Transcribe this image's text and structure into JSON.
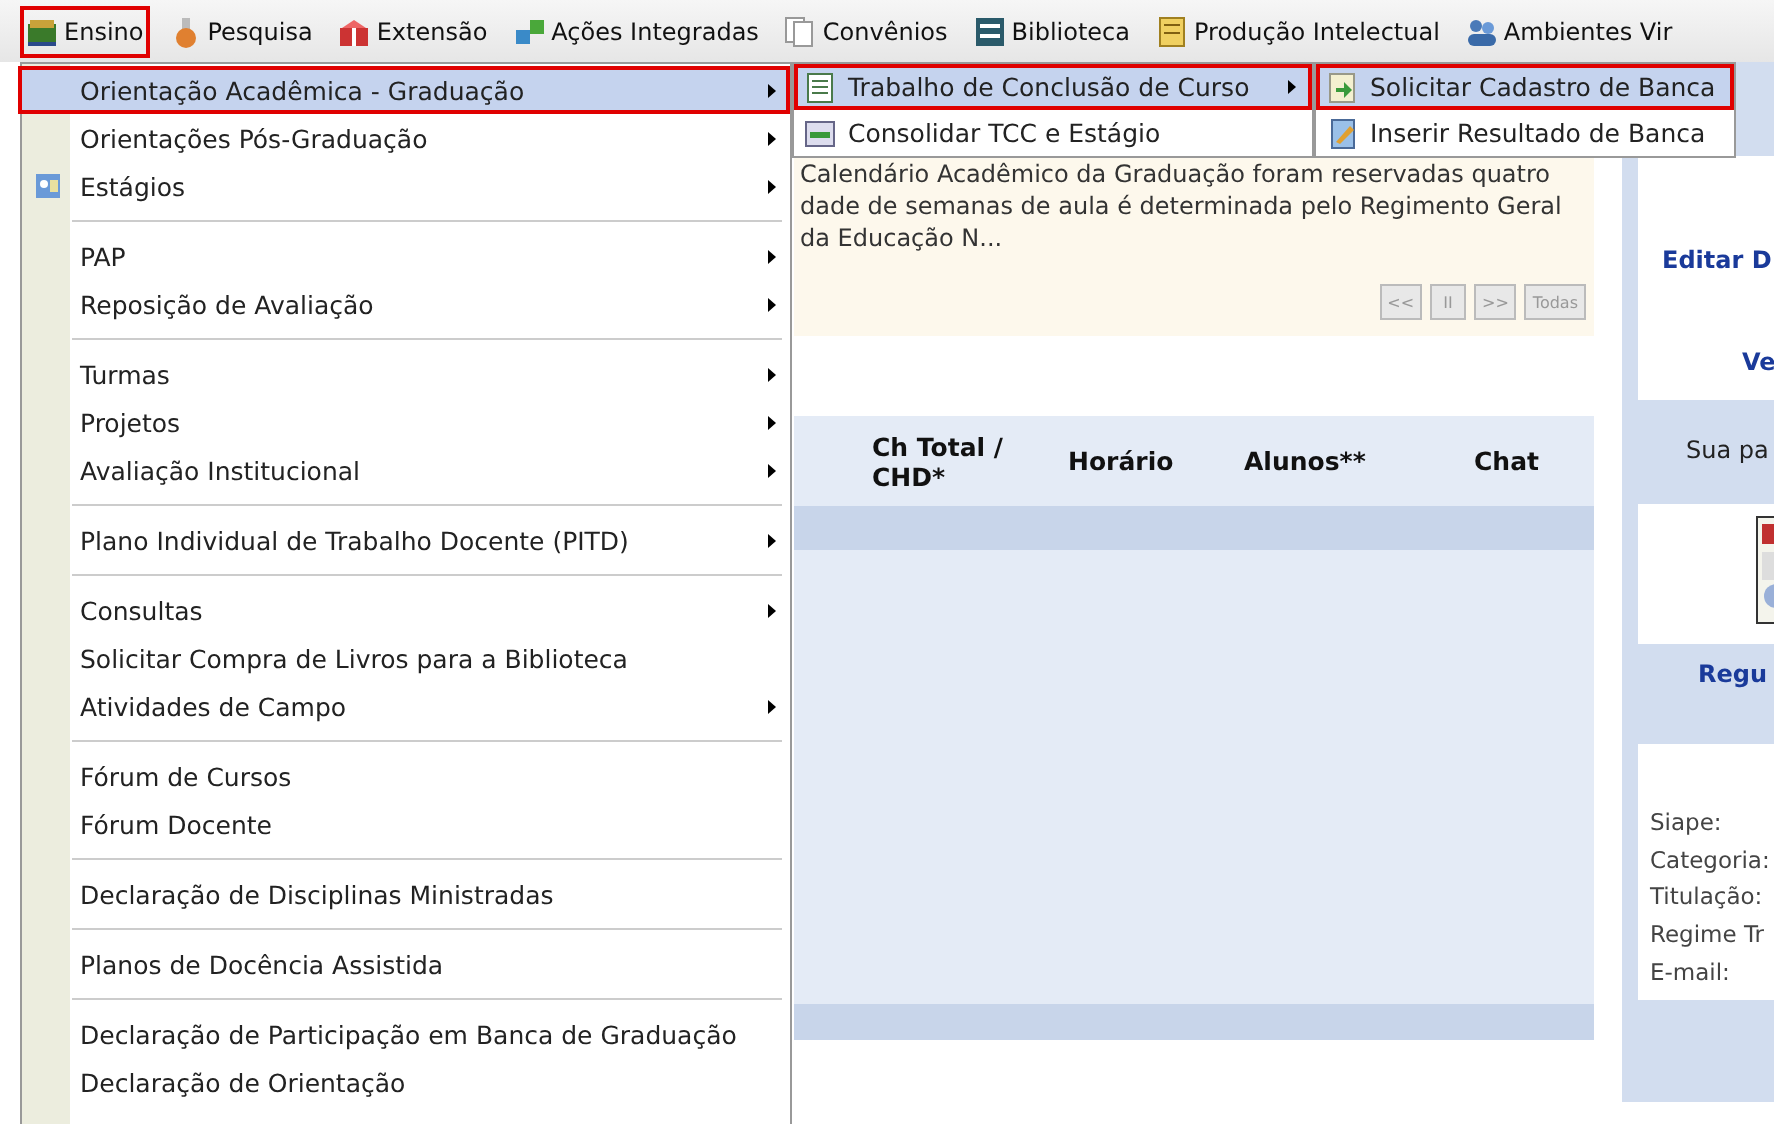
{
  "menubar": [
    {
      "label": "Ensino",
      "selected": true
    },
    {
      "label": "Pesquisa",
      "selected": false
    },
    {
      "label": "Extensão",
      "selected": false
    },
    {
      "label": "Ações Integradas",
      "selected": false
    },
    {
      "label": "Convênios",
      "selected": false
    },
    {
      "label": "Biblioteca",
      "selected": false
    },
    {
      "label": "Produção Intelectual",
      "selected": false
    },
    {
      "label": "Ambientes Vir",
      "selected": false
    }
  ],
  "menu": {
    "sections": [
      [
        {
          "label": "Orientação Acadêmica - Graduação",
          "has_submenu": true,
          "has_icon": false,
          "selected": true
        },
        {
          "label": "Orientações Pós-Graduação",
          "has_submenu": true,
          "has_icon": false,
          "selected": false
        },
        {
          "label": "Estágios",
          "has_submenu": true,
          "has_icon": true,
          "selected": false
        }
      ],
      [
        {
          "label": "PAP",
          "has_submenu": true,
          "has_icon": false,
          "selected": false
        },
        {
          "label": "Reposição de Avaliação",
          "has_submenu": true,
          "has_icon": false,
          "selected": false
        }
      ],
      [
        {
          "label": "Turmas",
          "has_submenu": true,
          "has_icon": false,
          "selected": false
        },
        {
          "label": "Projetos",
          "has_submenu": true,
          "has_icon": false,
          "selected": false
        },
        {
          "label": "Avaliação Institucional",
          "has_submenu": true,
          "has_icon": false,
          "selected": false
        }
      ],
      [
        {
          "label": "Plano Individual de Trabalho Docente (PITD)",
          "has_submenu": true,
          "has_icon": false,
          "selected": false
        }
      ],
      [
        {
          "label": "Consultas",
          "has_submenu": true,
          "has_icon": false,
          "selected": false
        },
        {
          "label": "Solicitar Compra de Livros para a Biblioteca",
          "has_submenu": false,
          "has_icon": false,
          "selected": false
        },
        {
          "label": "Atividades de Campo",
          "has_submenu": true,
          "has_icon": false,
          "selected": false
        }
      ],
      [
        {
          "label": "Fórum de Cursos",
          "has_submenu": false,
          "has_icon": false,
          "selected": false
        },
        {
          "label": "Fórum Docente",
          "has_submenu": false,
          "has_icon": false,
          "selected": false
        }
      ],
      [
        {
          "label": "Declaração de Disciplinas Ministradas",
          "has_submenu": false,
          "has_icon": false,
          "selected": false
        }
      ],
      [
        {
          "label": "Planos de Docência Assistida",
          "has_submenu": false,
          "has_icon": false,
          "selected": false
        }
      ],
      [
        {
          "label": "Declaração de Participação em Banca de Graduação",
          "has_submenu": false,
          "has_icon": false,
          "selected": false
        },
        {
          "label": "Declaração de Orientação",
          "has_submenu": false,
          "has_icon": false,
          "selected": false
        }
      ]
    ]
  },
  "submenu": [
    {
      "label": "Trabalho de Conclusão de Curso",
      "has_submenu": true,
      "selected": true
    },
    {
      "label": "Consolidar TCC e Estágio",
      "has_submenu": false,
      "selected": false
    }
  ],
  "submenu_2": [
    {
      "label": "Solicitar Cadastro de Banca",
      "selected": true
    },
    {
      "label": "Inserir Resultado de Banca",
      "selected": false
    }
  ],
  "notice": {
    "lines": [
      "Calendário Acadêmico da Graduação foram reservadas quatro",
      "dade de semanas de aula é determinada pelo Regimento Geral",
      "da Educação N..."
    ],
    "buttons": [
      "<<",
      "II",
      ">>",
      "Todas"
    ]
  },
  "table": {
    "columns": [
      "Ch Total / CHD*",
      "Horário",
      "Alunos**",
      "Chat"
    ]
  },
  "side": {
    "links": [
      "Editar D",
      "Ve"
    ],
    "text": "Sua pa",
    "link_2": "Regu",
    "fields": [
      "Siape:",
      "Categoria:",
      "Titulação:",
      "Regime Tr",
      "E-mail:"
    ]
  }
}
